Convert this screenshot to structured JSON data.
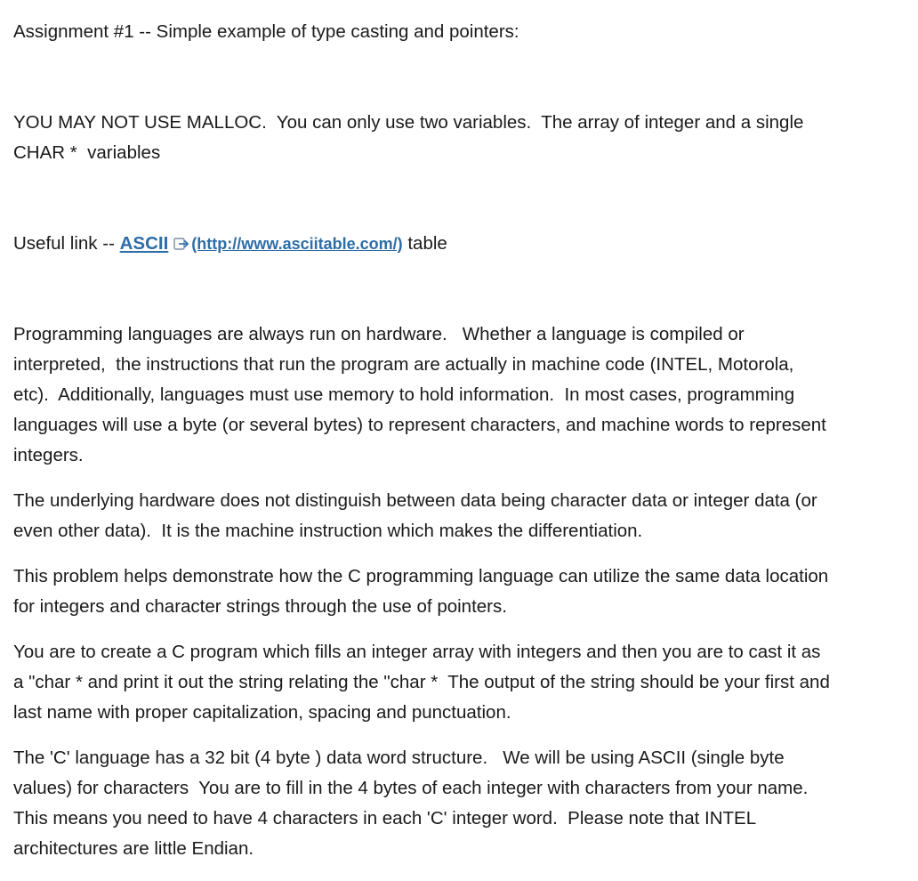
{
  "title": "Assignment #1 -- Simple example of type casting and pointers:",
  "malloc_note": {
    "line1": "YOU MAY NOT USE MALLOC.  You can only use two variables.  The array of integer and a single",
    "line2": "CHAR *  variables"
  },
  "useful_link": {
    "prefix": "Useful link -- ",
    "link_text": "ASCII",
    "icon": "external-link-icon",
    "url_text": "(http://www.asciitable.com/)",
    "suffix": " table",
    "link_color": "#2d6da8"
  },
  "paragraphs": {
    "programming": [
      "Programming languages are always run on hardware.   Whether a language is compiled or",
      "interpreted,  the instructions that run the program are actually in machine code (INTEL, Motorola,",
      "etc).  Additionally, languages must use memory to hold information.  In most cases, programming",
      "languages will use a byte (or several bytes) to represent characters, and machine words to represent",
      "integers."
    ],
    "hardware": [
      "The underlying hardware does not distinguish between data being character data or integer data (or",
      "even other data).  It is the machine instruction which makes the differentiation."
    ],
    "demonstrate": [
      "This problem helps demonstrate how the C programming language can utilize the same data location",
      "for integers and character strings through the use of pointers."
    ],
    "create": [
      "You are to create a C program which fills an integer array with integers and then you are to cast it as",
      "a \"char * and print it out the string relating the \"char *  The output of the string should be your first and",
      "last name with proper capitalization, spacing and punctuation."
    ],
    "word": [
      "The 'C' language has a 32 bit (4 byte ) data word structure.   We will be using ASCII (single byte",
      "values) for characters  You are to fill in the 4 bytes of each integer with characters from your name.",
      "This means you need to have 4 characters in each 'C' integer word.  Please note that INTEL",
      "architectures are little Endian."
    ]
  }
}
